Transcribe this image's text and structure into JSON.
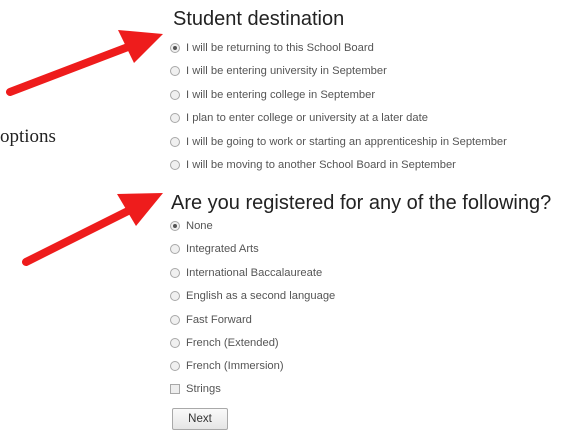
{
  "annotation": {
    "cut_text": "options",
    "arrow_color": "#ee1c1c"
  },
  "student_destination": {
    "title": "Student destination",
    "selected_index": 0,
    "options": [
      "I will be returning to this School Board",
      "I will be entering university in September",
      "I will be entering college in September",
      "I plan to enter college or university at a later date",
      "I will be going to work or starting an apprenticeship in September",
      "I will be moving to another School Board in September"
    ]
  },
  "registered_programs": {
    "title": "Are you registered for any of the following?",
    "selected_index": 0,
    "options": [
      "None",
      "Integrated Arts",
      "International Baccalaureate",
      "English as a second language",
      "Fast Forward",
      "French (Extended)",
      "French (Immersion)"
    ],
    "checkbox_label": "Strings",
    "checkbox_checked": false
  },
  "actions": {
    "next_label": "Next"
  }
}
